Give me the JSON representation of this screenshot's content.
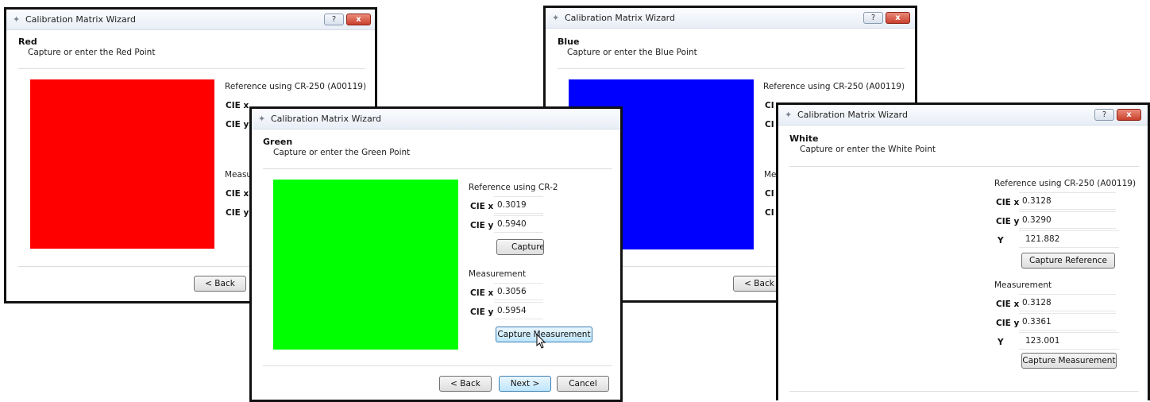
{
  "window_title": "Calibration Matrix Wizard",
  "titlebar": {
    "help_glyph": "?",
    "close_glyph": "x"
  },
  "buttons": {
    "back": "< Back",
    "next": "Next >",
    "cancel": "Cancel",
    "capture_reference": "Capture Reference",
    "capture_reference_partial": "Capture R",
    "capture_measurement": "Capture Measurement"
  },
  "labels": {
    "reference": "Reference using CR-250 (A00119)",
    "reference_partial": "Reference using CR-2",
    "measurement": "Measurement",
    "measurement_partial": "Measure",
    "cie_x": "CIE x",
    "cie_y": "CIE y",
    "cie_x_cut": "CIE",
    "big_y": "Y",
    "blue_clip_1": "CI",
    "blue_clip_2": "CI",
    "blue_clip_3": "Mea",
    "blue_clip_4": "CI",
    "blue_clip_5": "CI"
  },
  "windows": {
    "red": {
      "heading": "Red",
      "subheading": "Capture or enter the Red Point",
      "color": "#ff0000"
    },
    "green": {
      "heading": "Green",
      "subheading": "Capture or enter the Green Point",
      "color": "#00ff00",
      "ref_x": "0.3019",
      "ref_y": "0.5940",
      "meas_x": "0.3056",
      "meas_y": "0.5954"
    },
    "blue": {
      "heading": "Blue",
      "subheading": "Capture or enter the Blue Point",
      "color": "#0000ff"
    },
    "white": {
      "heading": "White",
      "subheading": "Capture or enter the White Point",
      "ref_x": "0.3128",
      "ref_y": "0.3290",
      "ref_Y": "121.882",
      "meas_x": "0.3128",
      "meas_y": "0.3361",
      "meas_Y": "123.001"
    }
  },
  "colors": {
    "titlebar_text": "#222222",
    "close_button": "#c9402c",
    "hover_button": "#bee6fd"
  }
}
